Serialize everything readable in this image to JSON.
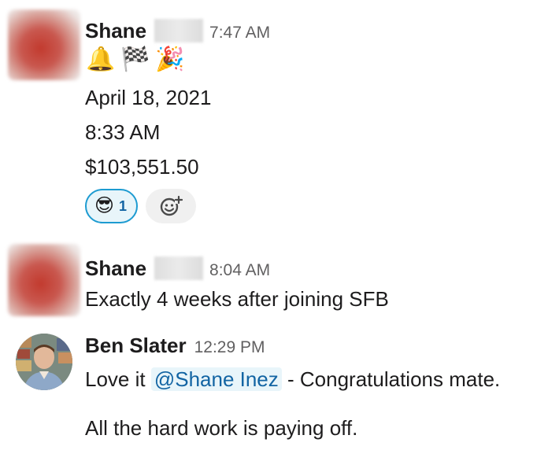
{
  "messages": [
    {
      "author": "Shane",
      "time": "7:47 AM",
      "emojis": [
        "🔔",
        "🏁",
        "🎉"
      ],
      "lines": [
        "April 18, 2021",
        "8:33 AM",
        "$103,551.50"
      ],
      "reaction": {
        "emoji": "😎",
        "count": "1"
      }
    },
    {
      "author": "Shane",
      "time": "8:04 AM",
      "lines": [
        "Exactly 4 weeks after joining SFB"
      ]
    },
    {
      "author": "Ben Slater",
      "time": "12:29 PM",
      "text_before": "Love it ",
      "mention": "@Shane Inez",
      "text_after": " - Congratulations mate.",
      "line2": "All the hard work is paying off."
    }
  ],
  "colors": {
    "text": "#1d1c1d",
    "timestamp": "#616061",
    "reaction_border": "#1d9bd1",
    "reaction_bg": "#e8f5fa",
    "mention_text": "#1264a3"
  },
  "icons": {
    "add_reaction": "add-reaction-icon"
  }
}
